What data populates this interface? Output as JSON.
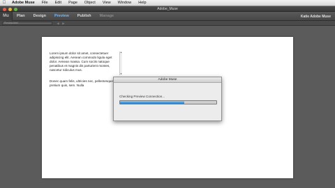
{
  "menubar": {
    "apple_icon": "apple-icon",
    "items": [
      "Adobe Muse",
      "File",
      "Edit",
      "Page",
      "Object",
      "View",
      "Window",
      "Help"
    ]
  },
  "window": {
    "title": "Adobe_Muse"
  },
  "toolbar": {
    "logo": "Mu",
    "modes": [
      {
        "label": "Plan",
        "state": "normal"
      },
      {
        "label": "Design",
        "state": "normal"
      },
      {
        "label": "Preview",
        "state": "active"
      },
      {
        "label": "Publish",
        "state": "normal"
      },
      {
        "label": "Manage",
        "state": "disabled"
      }
    ],
    "user_link": "Katie Adobe Muse",
    "active_color": "#79b6ee"
  },
  "subbar": {
    "url_placeholder": "Preview.html"
  },
  "canvas": {
    "paragraph1": "Lorem ipsum dolor sit amet, consectetuer adipiscing elit. Aenean commodo ligula eget dolor. Aenean massa. Cum sociis natoque penatibus et magnis dis parturient montes, nascetur ridiculus mus.",
    "paragraph2": "Donec quam felis, ultricies nec, pellentesque eu, pretium quis, sem. Nulla"
  },
  "dialog": {
    "title": "Adobe Muse",
    "message": "Checking Preview Connection...",
    "progress_fraction": 0.67,
    "progress_color": "#3e95dd"
  }
}
